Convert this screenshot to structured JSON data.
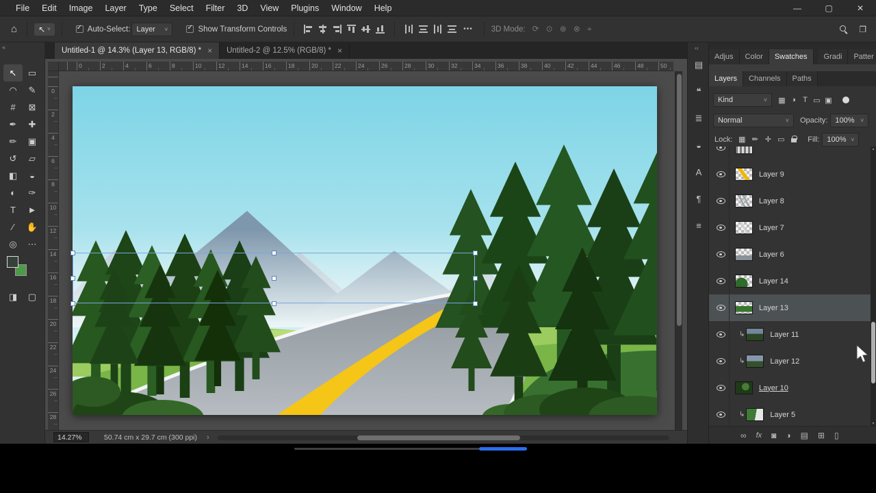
{
  "window": {
    "menus": [
      "File",
      "Edit",
      "Image",
      "Layer",
      "Type",
      "Select",
      "Filter",
      "3D",
      "View",
      "Plugins",
      "Window",
      "Help"
    ],
    "controls": {
      "minimize": "—",
      "maximize": "▢",
      "close": "✕"
    }
  },
  "options_bar": {
    "home_icon": "⌂",
    "tool_icon": "↖",
    "tool_caret": "˅",
    "auto_select": {
      "label": "Auto-Select:",
      "value": "Layer"
    },
    "show_transform_label": "Show Transform Controls",
    "more_icon": "•••",
    "mode_3d_label": "3D Mode:",
    "mode_3d_icons": [
      "⟳",
      "⊙",
      "⊕",
      "⊗",
      "⌖"
    ],
    "workspace_icon": "❐"
  },
  "doc_tabs": [
    {
      "label": "Untitled-1 @ 14.3% (Layer 13, RGB/8) *",
      "close": "×",
      "active": true
    },
    {
      "label": "Untitled-2 @ 12.5% (RGB/8) *",
      "close": "×",
      "active": false
    }
  ],
  "toolbar": {
    "collapse_icon": "«",
    "tools": [
      {
        "name": "move-tool",
        "glyph": "↖",
        "active": true
      },
      {
        "name": "marquee-tool",
        "glyph": "▭"
      },
      {
        "name": "lasso-tool",
        "glyph": "◠"
      },
      {
        "name": "quick-selection-tool",
        "glyph": "✎"
      },
      {
        "name": "crop-tool",
        "glyph": "#"
      },
      {
        "name": "frame-tool",
        "glyph": "⊠"
      },
      {
        "name": "eyedropper-tool",
        "glyph": "✒"
      },
      {
        "name": "healing-brush-tool",
        "glyph": "✚"
      },
      {
        "name": "brush-tool",
        "glyph": "✏"
      },
      {
        "name": "clone-stamp-tool",
        "glyph": "▣"
      },
      {
        "name": "history-brush-tool",
        "glyph": "↺"
      },
      {
        "name": "eraser-tool",
        "glyph": "▱"
      },
      {
        "name": "gradient-tool",
        "glyph": "◧"
      },
      {
        "name": "blur-tool",
        "glyph": "◒"
      },
      {
        "name": "dodge-tool",
        "glyph": "◐"
      },
      {
        "name": "pen-tool",
        "glyph": "✑"
      },
      {
        "name": "type-tool",
        "glyph": "T"
      },
      {
        "name": "path-selection-tool",
        "glyph": "►"
      },
      {
        "name": "line-tool",
        "glyph": "∕"
      },
      {
        "name": "hand-tool",
        "glyph": "✋"
      },
      {
        "name": "zoom-tool",
        "glyph": "◎"
      },
      {
        "name": "edit-toolbar-button",
        "glyph": "⋯"
      }
    ],
    "bottom_tools": [
      {
        "name": "quick-mask-button",
        "glyph": "◨"
      },
      {
        "name": "screen-mode-button",
        "glyph": "▢"
      }
    ],
    "foreground_color": "#35413a",
    "background_color": "#4e9a4a"
  },
  "rulers": {
    "top": [
      "0",
      "2",
      "4",
      "6",
      "8",
      "10",
      "12",
      "14",
      "16",
      "18",
      "20",
      "22",
      "24",
      "26",
      "28",
      "30",
      "32",
      "34",
      "36",
      "38",
      "40",
      "42",
      "44",
      "46",
      "48",
      "50"
    ],
    "left": [
      "0",
      "2",
      "4",
      "6",
      "8",
      "10",
      "12",
      "14",
      "16",
      "18",
      "20",
      "22",
      "24",
      "26",
      "28"
    ]
  },
  "status_bar": {
    "zoom": "14.27%",
    "doc_info": "50.74 cm x 29.7 cm (300 ppi)",
    "arrow_right": "›",
    "arrow_left": "‹"
  },
  "dock": {
    "collapse_icon": "‹‹",
    "icons": [
      {
        "name": "history-panel-button",
        "glyph": "▤"
      },
      {
        "name": "comments-panel-button",
        "glyph": "❝"
      },
      {
        "name": "properties-panel-button",
        "glyph": "≣"
      },
      {
        "name": "adjustments-panel-button",
        "glyph": "◒"
      },
      {
        "name": "character-panel-button",
        "glyph": "A"
      },
      {
        "name": "paragraph-panel-button",
        "glyph": "¶"
      },
      {
        "name": "glyphs-panel-button",
        "glyph": "≡"
      }
    ]
  },
  "panels": {
    "tab_row1": [
      {
        "label": "Adjus",
        "active": false,
        "group": 1
      },
      {
        "label": "Color",
        "active": false,
        "group": 1
      },
      {
        "label": "Swatches",
        "active": true,
        "group": 1
      },
      {
        "label": "Gradi",
        "active": false,
        "group": 2
      },
      {
        "label": "Patter",
        "active": false,
        "group": 2
      }
    ],
    "tab_row2": [
      {
        "label": "Layers",
        "active": true
      },
      {
        "label": "Channels",
        "active": false
      },
      {
        "label": "Paths",
        "active": false
      }
    ],
    "filter": {
      "kind": "Kind",
      "icons": [
        {
          "name": "filter-pixel-layers-icon",
          "glyph": "▦"
        },
        {
          "name": "filter-adjustment-layers-icon",
          "glyph": "◑"
        },
        {
          "name": "filter-type-layers-icon",
          "glyph": "T"
        },
        {
          "name": "filter-shape-layers-icon",
          "glyph": "▭"
        },
        {
          "name": "filter-smart-objects-icon",
          "glyph": "▣"
        }
      ],
      "toggle_color": "#d9d9d9"
    },
    "blend": {
      "mode": "Normal",
      "opacity_label": "Opacity:",
      "opacity": "100%"
    },
    "lock": {
      "label": "Lock:",
      "icons": [
        {
          "name": "lock-transparent-pixels-icon",
          "glyph": "▦"
        },
        {
          "name": "lock-image-pixels-icon",
          "glyph": "✏"
        },
        {
          "name": "lock-position-icon",
          "glyph": "✛"
        },
        {
          "name": "lock-artboard-icon",
          "glyph": "▭"
        },
        {
          "name": "lock-all-icon",
          "glyph": "css-lock"
        }
      ],
      "fill_label": "Fill:",
      "fill": "100%"
    },
    "clip_arrow": "↳",
    "layers": [
      {
        "name": "",
        "thumb": "stripes",
        "partial": true
      },
      {
        "name": "Layer 9",
        "thumb": "yellow"
      },
      {
        "name": "Layer 8",
        "thumb": "graylines"
      },
      {
        "name": "Layer 7",
        "thumb": "faint"
      },
      {
        "name": "Layer 6",
        "thumb": "graywedge"
      },
      {
        "name": "Layer 14",
        "thumb": "greenblob"
      },
      {
        "name": "Layer 13",
        "thumb": "greenstrip",
        "selected": true
      },
      {
        "name": "Layer 11",
        "thumb": "scene1",
        "clipped": true
      },
      {
        "name": "Layer 12",
        "thumb": "scene2",
        "clipped": true
      },
      {
        "name": "Layer 10",
        "thumb": "darkgreen",
        "underlined": true
      },
      {
        "name": "Layer 5",
        "thumb": "mixed",
        "clipped": true
      }
    ],
    "bottom_icons": [
      {
        "name": "link-layers-button",
        "glyph": "∞"
      },
      {
        "name": "layer-effects-button",
        "glyph": "fx"
      },
      {
        "name": "add-layer-mask-button",
        "glyph": "◙"
      },
      {
        "name": "adjustment-layer-button",
        "glyph": "◑"
      },
      {
        "name": "group-layers-button",
        "glyph": "▤"
      },
      {
        "name": "new-layer-button",
        "glyph": "⊞"
      },
      {
        "name": "delete-layer-button",
        "glyph": "▯"
      }
    ]
  },
  "video_bar": {
    "track_color": "#3f3f3f",
    "progress_color": "#2a6df0"
  }
}
